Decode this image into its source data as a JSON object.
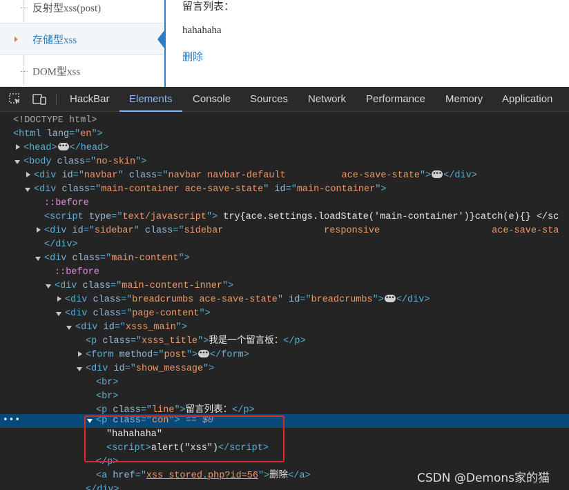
{
  "sidebar": {
    "items": [
      {
        "label": "反射型xss(post)"
      },
      {
        "label": "存储型xss",
        "active": true
      },
      {
        "label": "DOM型xss"
      }
    ]
  },
  "content": {
    "title": "留言列表：",
    "message": "hahahaha",
    "delete_link": "删除"
  },
  "devtools": {
    "tabs": [
      {
        "label": "HackBar"
      },
      {
        "label": "Elements",
        "active": true
      },
      {
        "label": "Console"
      },
      {
        "label": "Sources"
      },
      {
        "label": "Network"
      },
      {
        "label": "Performance"
      },
      {
        "label": "Memory"
      },
      {
        "label": "Application"
      }
    ],
    "icons": [
      "inspect-element-icon",
      "device-toggle-icon"
    ],
    "selected_suffix": "== $0",
    "code": {
      "doctype": "<!DOCTYPE html>",
      "html_lang": "en",
      "body_class": "no-skin",
      "navbar_id": "navbar",
      "navbar_class": "navbar navbar-default          ace-save-state",
      "main_container_class": "main-container ace-save-state",
      "main_container_id": "main-container",
      "before": "::before",
      "script_type": "text/javascript",
      "script_content": " try{ace.settings.loadState('main-container')}catch(e){} </sc",
      "sidebar_id": "sidebar",
      "sidebar_class": "sidebar                  responsive                    ace-save-sta",
      "main_content_class": "main-content",
      "main_content_inner_class": "main-content-inner",
      "breadcrumbs_class": "breadcrumbs ace-save-state",
      "breadcrumbs_id": "breadcrumbs",
      "page_content_class": "page-content",
      "xsss_main_id": "xsss_main",
      "xsss_title_class": "xsss_title",
      "xsss_title_text": "我是一个留言板：",
      "form_method": "post",
      "show_message_id": "show_message",
      "line_class": "line",
      "line_text": "留言列表：",
      "con_class": "con",
      "hahahaha_text": "\"hahahaha\"",
      "alert_text": "alert(\"xss\")",
      "href_value": "xss_stored.php?id=56",
      "delete_text": "删除"
    }
  },
  "watermark": "CSDN @Demons家的猫",
  "colors": {
    "sidebar_accent": "#2f7cc4",
    "link": "#2b7dbc",
    "devtools_bg": "#242424",
    "selection": "#074a7a",
    "highlight_box": "#e3262c",
    "tag": "#5db0d7",
    "attr_value": "#f29766"
  }
}
